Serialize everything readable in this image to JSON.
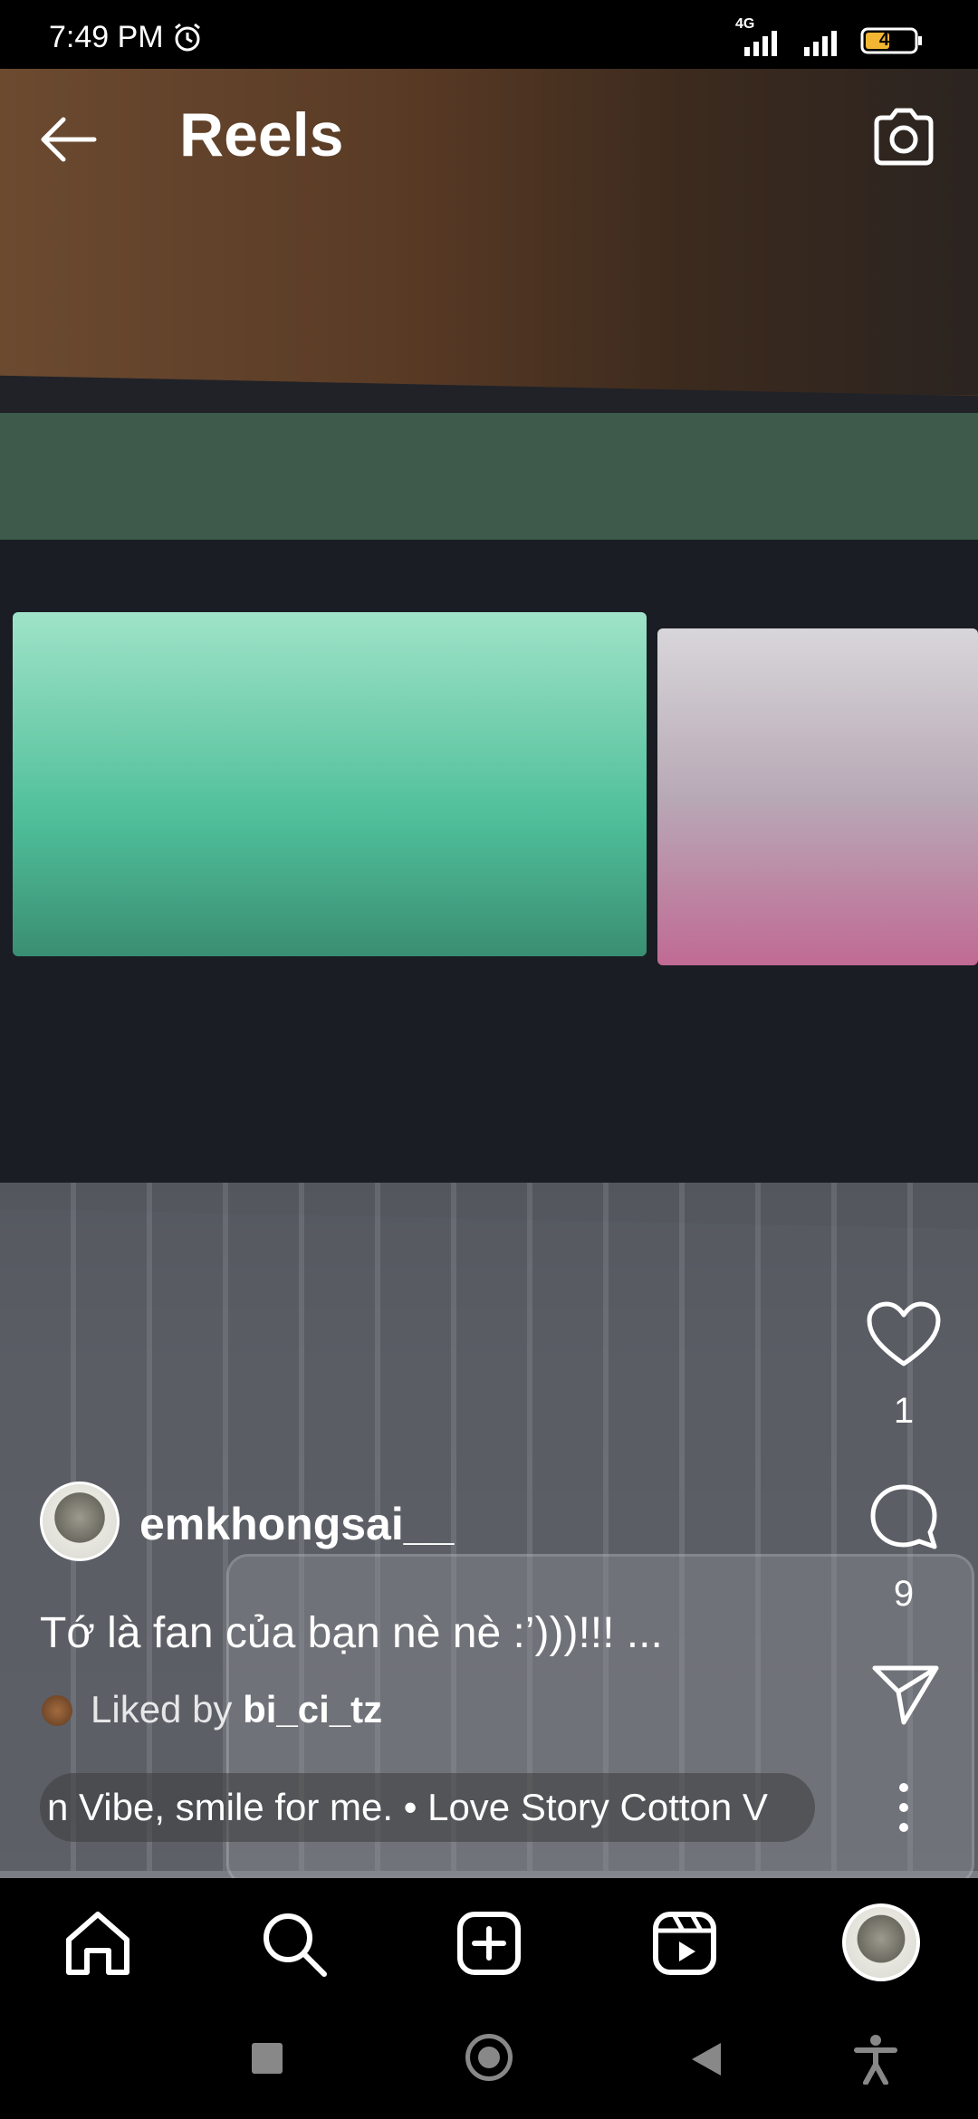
{
  "status_bar": {
    "time": "7:49 PM",
    "network": "4G",
    "battery": "46"
  },
  "header": {
    "title": "Reels"
  },
  "actions": {
    "like_count": "1",
    "comment_count": "9"
  },
  "post": {
    "username": "emkhongsai__",
    "caption": "Tớ là fan của bạn nè nè :’)))!!! ...",
    "liked_by_prefix": "Liked by ",
    "liked_by_user": "bi_ci_tz",
    "audio": "n Vibe, smile for me. • Love Story   Cotton V"
  },
  "icons": {
    "back": "arrow-left-icon",
    "camera": "camera-icon",
    "like": "heart-icon",
    "comment": "comment-bubble-icon",
    "share": "paper-plane-icon",
    "more": "vertical-dots-icon",
    "nav": [
      "home-icon",
      "search-icon",
      "create-icon",
      "reels-icon",
      "profile-avatar"
    ]
  }
}
